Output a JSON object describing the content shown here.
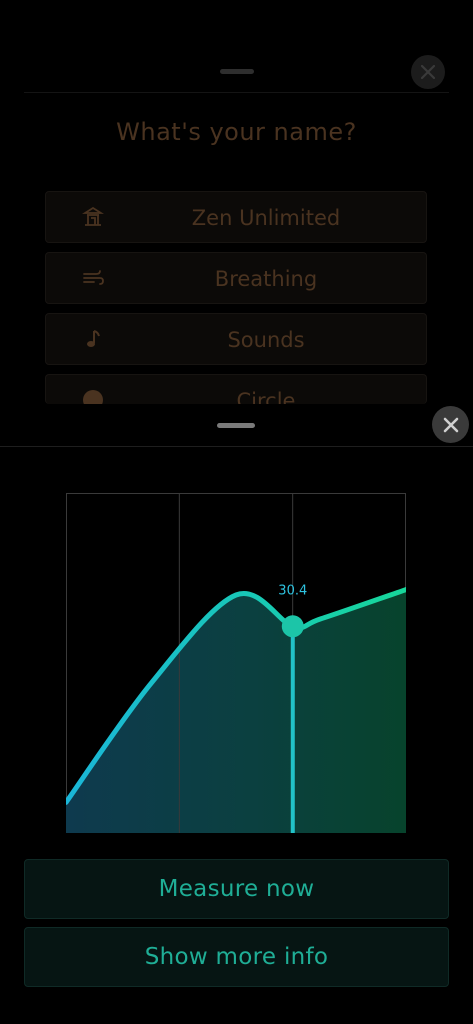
{
  "background_sheet": {
    "title": "What's your name?",
    "options": [
      {
        "label": "Zen Unlimited",
        "icon": "temple-icon"
      },
      {
        "label": "Breathing",
        "icon": "wind-icon"
      },
      {
        "label": "Sounds",
        "icon": "music-note-icon"
      },
      {
        "label": "Circle",
        "icon": "circle-icon"
      }
    ]
  },
  "chart_data": {
    "type": "area",
    "x": [
      0,
      0.25,
      0.5,
      0.667,
      0.75,
      1.0
    ],
    "y": [
      4.5,
      22.0,
      35.0,
      30.4,
      31.5,
      35.8
    ],
    "ylim": [
      0,
      50
    ],
    "xlim": [
      0,
      1
    ],
    "highlight": {
      "x": 0.667,
      "value": "30.4"
    },
    "grid": "vertical lines at thirds",
    "colors": {
      "start": "#1ab6d8",
      "end": "#17d79a"
    }
  },
  "buttons": {
    "measure": "Measure now",
    "more_info": "Show more info"
  },
  "colors": {
    "accent": "#1fae96",
    "dim_text": "#4a3320"
  }
}
